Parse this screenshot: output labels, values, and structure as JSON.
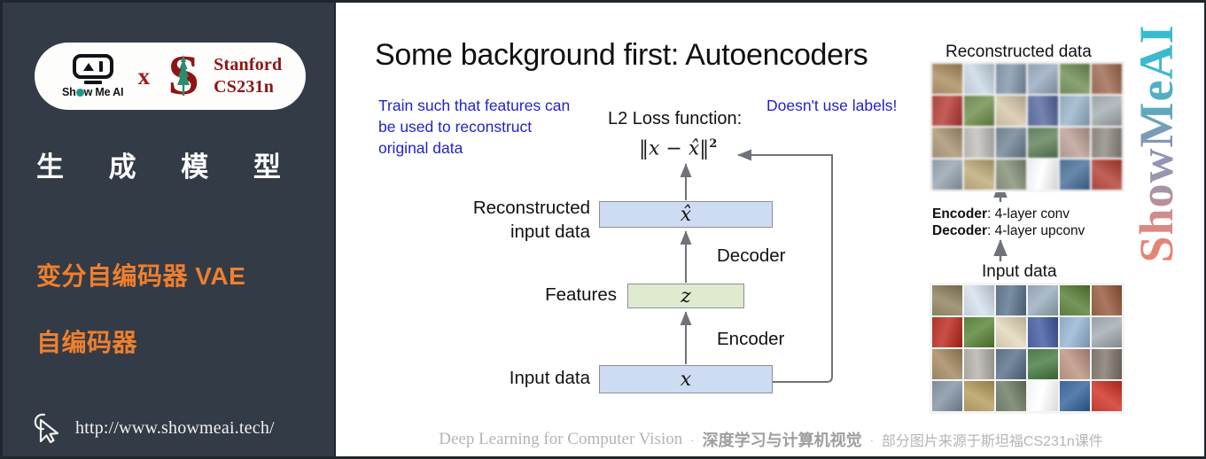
{
  "sidebar": {
    "logo": {
      "showmeai_name": "Show Me AI",
      "cross_symbol": "x",
      "stanford_line1": "Stanford",
      "stanford_line2": "CS231n",
      "stanford_s_glyph": "S"
    },
    "title": "生 成 模 型",
    "subtitle_1": "变分自编码器 VAE",
    "subtitle_2": "自编码器",
    "url": "http://www.showmeai.tech/",
    "cursor_icon": "cursor-arrow-icon",
    "bg_color": "#333b47",
    "accent_color": "#ef7f2e"
  },
  "slide": {
    "title": "Some background first: Autoencoders",
    "note_left": "Train such that features can be used to reconstruct original data",
    "note_right": "Doesn't use labels!",
    "note_color": "#2222cc",
    "loss_label": "L2 Loss function:",
    "loss_formula_lhs": "‖x − x̂‖",
    "loss_formula_exp": "2",
    "diagram": {
      "box_xhat_label": "x̂",
      "box_z_label": "z",
      "box_x_label": "x",
      "label_reconstructed_line1": "Reconstructed",
      "label_reconstructed_line2": "input data",
      "label_features": "Features",
      "label_input": "Input data",
      "label_decoder": "Decoder",
      "label_encoder": "Encoder",
      "box_blue_color": "#cddcf2",
      "box_green_color": "#dfeacf"
    },
    "panels": {
      "caption_reconstructed": "Reconstructed data",
      "caption_input": "Input data",
      "encoder_key": "Encoder",
      "encoder_value": ": 4-layer conv",
      "decoder_key": "Decoder",
      "decoder_value": ": 4-layer upconv"
    },
    "watermark": "ShowMeAI",
    "footer": {
      "english": "Deep Learning for Computer Vision",
      "separator": "·",
      "chinese_bold": "深度学习与计算机视觉",
      "chinese_note": "部分图片来源于斯坦福CS231n课件"
    }
  },
  "image_grids": {
    "reconstructed": [
      [
        "#a3885e",
        "#b9c6d2",
        "#7d91a4",
        "#8fa0b2",
        "#6f8a55",
        "#9c6a52"
      ],
      [
        "#b5413a",
        "#6e8a4c",
        "#c4b79c",
        "#5a6a9e",
        "#8fa7bd",
        "#9aa3a8"
      ],
      [
        "#a08d6e",
        "#b3b2ad",
        "#6d7f90",
        "#5f7f5a",
        "#b0968c",
        "#8c857e"
      ],
      [
        "#8d9aa6",
        "#b2a071",
        "#7f8a74",
        "#e8eaec",
        "#4a6f97",
        "#b2443a"
      ]
    ],
    "input": [
      [
        "#8b7f62",
        "#c2cdd7",
        "#5f7488",
        "#93a2b0",
        "#5d7c3f",
        "#8f5e44"
      ],
      [
        "#b0352c",
        "#5c8040",
        "#cfc5ad",
        "#4a5e9a",
        "#8fa9c2",
        "#9aa1a6"
      ],
      [
        "#9a8463",
        "#a9a7a0",
        "#5d6f84",
        "#4e7a4a",
        "#b08c7e",
        "#7e766d"
      ],
      [
        "#7f8d9b",
        "#a89560",
        "#6e7a65",
        "#f2f3f4",
        "#3d6694",
        "#bf3c30"
      ]
    ]
  }
}
